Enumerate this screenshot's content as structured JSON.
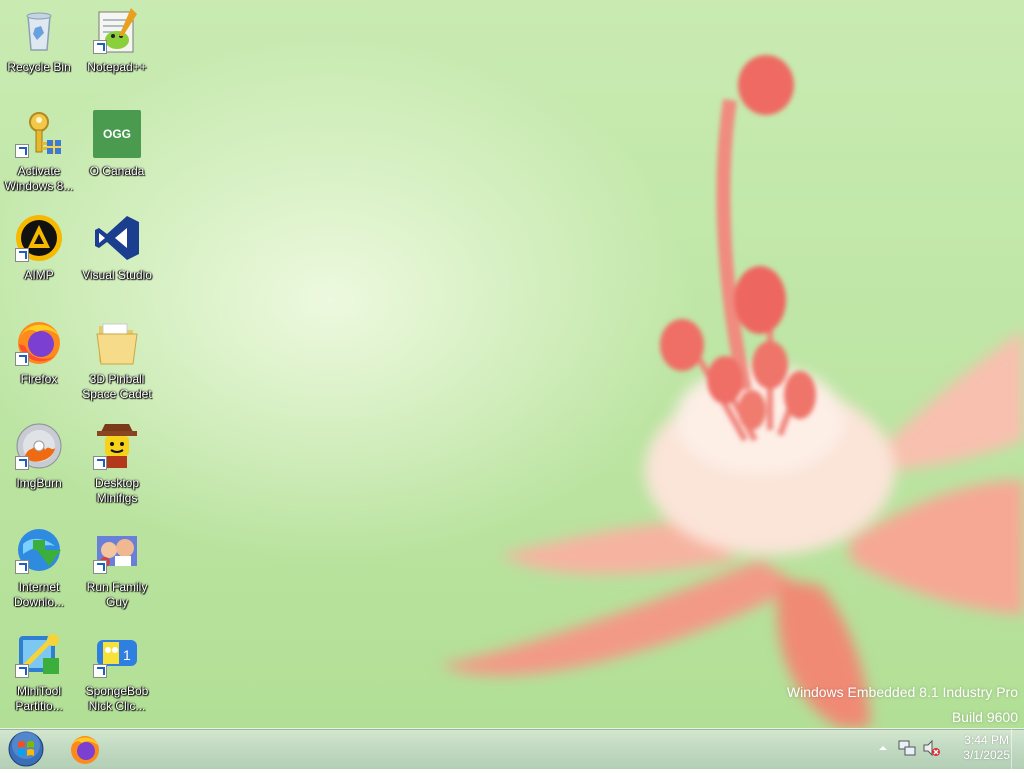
{
  "desktop_icons": [
    {
      "label": "Recycle Bin",
      "icon": "recycle-bin-icon",
      "shortcut": false
    },
    {
      "label": "Notepad++",
      "icon": "notepad-plus-plus-icon",
      "shortcut": true
    },
    {
      "label": "Activate\nWindows 8...",
      "icon": "key-icon",
      "shortcut": true
    },
    {
      "label": "O Canada",
      "icon": "ogg-file-icon",
      "badge": "OGG",
      "shortcut": false
    },
    {
      "label": "AIMP",
      "icon": "aimp-icon",
      "shortcut": true
    },
    {
      "label": "Visual Studio",
      "icon": "visual-studio-icon",
      "shortcut": false
    },
    {
      "label": "Firefox",
      "icon": "firefox-icon",
      "shortcut": true
    },
    {
      "label": "3D Pinball\nSpace Cadet",
      "icon": "folder-icon",
      "shortcut": false
    },
    {
      "label": "ImgBurn",
      "icon": "imgburn-disc-icon",
      "shortcut": true
    },
    {
      "label": "Desktop\nMinifigs",
      "icon": "minifig-icon",
      "shortcut": true
    },
    {
      "label": "Internet\nDownlo...",
      "icon": "internet-download-manager-icon",
      "shortcut": true
    },
    {
      "label": "Run Family\nGuy",
      "icon": "family-guy-icon",
      "shortcut": true
    },
    {
      "label": "MiniTool\nPartitio...",
      "icon": "minitool-partition-icon",
      "shortcut": true
    },
    {
      "label": "SpongeBob\nNick Clic...",
      "icon": "spongebob-icon",
      "shortcut": true
    }
  ],
  "watermark": {
    "line1": "Windows Embedded 8.1 Industry Pro",
    "line2": "Build 9600"
  },
  "taskbar": {
    "start_icon": "windows-start-orb-icon",
    "pinned": [
      {
        "name": "Firefox",
        "icon": "firefox-icon"
      }
    ],
    "tray": {
      "overflow_icon": "chevron-up-icon",
      "network_icon": "network-icon",
      "volume_icon": "volume-muted-icon",
      "time": "3:44 PM",
      "date": "3/1/2025"
    }
  },
  "colors": {
    "wallpaper_green": "#c2e8aa",
    "petal_pink": "#f4a08c",
    "taskbar": "#c4dcc2"
  }
}
